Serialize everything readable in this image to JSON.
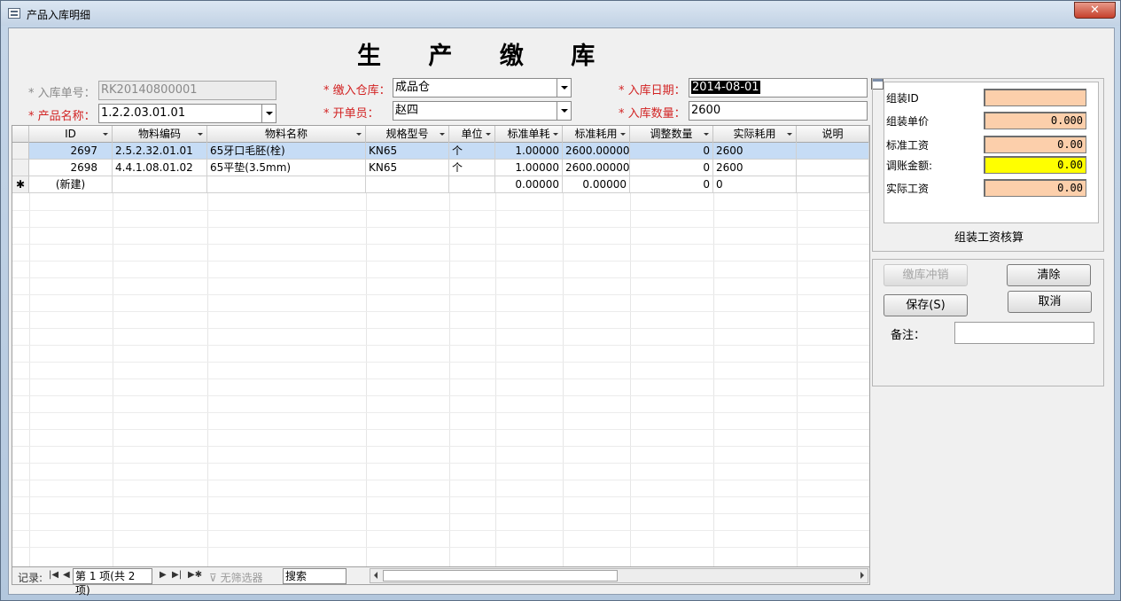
{
  "window": {
    "title": "产品入库明细",
    "close_label": "✕"
  },
  "form": {
    "title": "生 产 缴 库",
    "labels": {
      "receipt_no": "* 入库单号：",
      "product_name": "* 产品名称：",
      "warehouse": "* 缴入仓库：",
      "issuer": "* 开单员：",
      "date": "* 入库日期：",
      "quantity": "* 入库数量："
    },
    "values": {
      "receipt_no": "RK20140800001",
      "product_name": "1.2.2.03.01.01",
      "warehouse": "成品仓",
      "issuer": "赵四",
      "date": "2014-08-01",
      "quantity": "2600"
    }
  },
  "grid": {
    "columns": [
      "ID",
      "物料编码",
      "物料名称",
      "规格型号",
      "单位",
      "标准单耗",
      "标准耗用",
      "调整数量",
      "实际耗用",
      "说明"
    ],
    "rows": [
      {
        "selector": "",
        "id": "2697",
        "code": "2.5.2.32.01.01",
        "name": "65牙口毛胚(栓)",
        "spec": "KN65",
        "unit": "个",
        "std_unit": "1.00000",
        "std_use": "2600.00000",
        "adj": "0",
        "actual": "2600",
        "note": ""
      },
      {
        "selector": "",
        "id": "2698",
        "code": "4.4.1.08.01.02",
        "name": "65平垫(3.5mm)",
        "spec": "KN65",
        "unit": "个",
        "std_unit": "1.00000",
        "std_use": "2600.00000",
        "adj": "0",
        "actual": "2600",
        "note": ""
      },
      {
        "selector": "✱",
        "id": "(新建)",
        "code": "",
        "name": "",
        "spec": "",
        "unit": "",
        "std_unit": "0.00000",
        "std_use": "0.00000",
        "adj": "0",
        "actual": "0",
        "note": ""
      }
    ]
  },
  "navbar": {
    "record_label": "记录:",
    "position": "第 1 项(共 2 项)",
    "filter_label": "无筛选器",
    "search_label": "搜索"
  },
  "assembly": {
    "labels": {
      "id": "组装ID",
      "unit_price": "组装单价",
      "std_wage": "标准工资",
      "adjust_amount": "调账金额:",
      "actual_wage": "实际工资"
    },
    "values": {
      "id": "",
      "unit_price": "0.000",
      "std_wage": "0.00",
      "adjust_amount": "0.00",
      "actual_wage": "0.00"
    },
    "caption": "组装工资核算"
  },
  "actions": {
    "reverse": "缴库冲销",
    "clear": "清除",
    "save": "保存(S)",
    "cancel": "取消",
    "memo_label": "备注："
  },
  "colors": {
    "required_label": "#d22323",
    "selected_row": "#c6dcf5",
    "wage_field": "#fccfab",
    "highlight_field": "#ffff00"
  }
}
